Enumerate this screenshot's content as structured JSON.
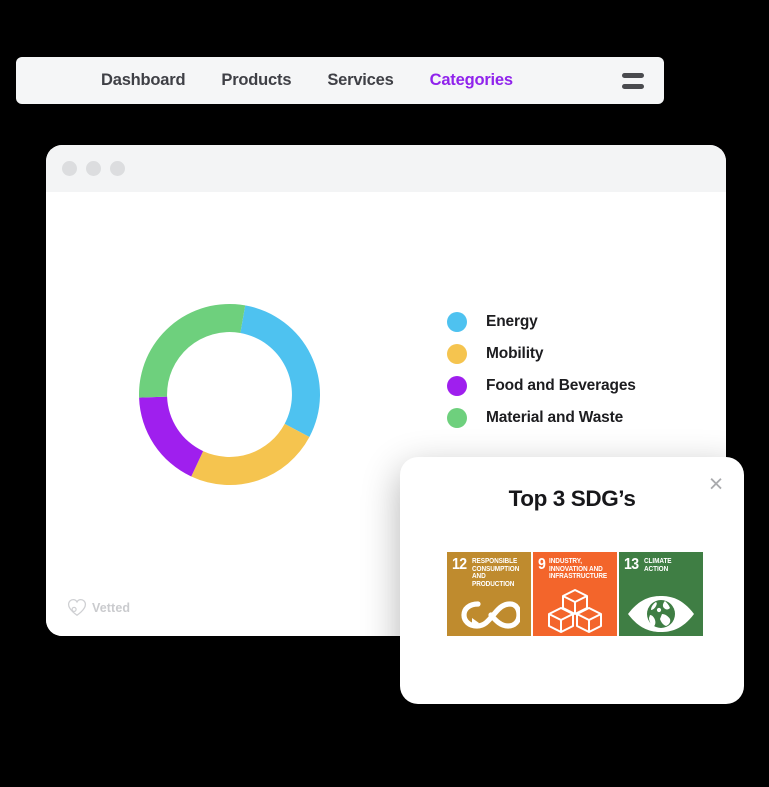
{
  "page": {
    "background_color": "#000000"
  },
  "browser": {
    "title_bar": {
      "dots": [
        "window-dot-1",
        "window-dot-2",
        "window-dot-3"
      ],
      "dot_color": "#dcdddf"
    },
    "nav": {
      "items": [
        {
          "label": "Dashboard",
          "active": false
        },
        {
          "label": "Products",
          "active": false
        },
        {
          "label": "Services",
          "active": false
        },
        {
          "label": "Categories",
          "active": true
        }
      ],
      "active_color": "#9023ec",
      "inactive_color": "#3f4046",
      "menu_icon": "hamburger-icon"
    }
  },
  "chart_data": {
    "type": "pie",
    "title": "",
    "variant": "donut",
    "categories": [
      "Energy",
      "Mobility",
      "Food and Beverages",
      "Material and Waste"
    ],
    "values": [
      30,
      24,
      17.5,
      28.5
    ],
    "unit": "%",
    "colors": [
      "#4ec2f0",
      "#f4c košice"
    ],
    "series_colors": [
      "#4ec2f0",
      "#f5c44f",
      "#9f1fee",
      "#6ed07d"
    ],
    "start_angle_deg": 10,
    "legend_position": "right",
    "inner_radius_ratio": 0.69,
    "segments": [
      {
        "label": "Energy",
        "value": 30,
        "color": "#4ec2f0",
        "start_deg": 10,
        "end_deg": 118
      },
      {
        "label": "Mobility",
        "value": 24,
        "color": "#f5c44f",
        "start_deg": 118,
        "end_deg": 205
      },
      {
        "label": "Food and Beverages",
        "value": 17.5,
        "color": "#9f1fee",
        "start_deg": 205,
        "end_deg": 268
      },
      {
        "label": "Material and Waste",
        "value": 28.5,
        "color": "#6ed07d",
        "start_deg": 268,
        "end_deg": 370
      }
    ]
  },
  "legend": {
    "items": [
      {
        "label": "Energy",
        "color": "#4ec2f0"
      },
      {
        "label": "Mobility",
        "color": "#f5c44f"
      },
      {
        "label": "Food and Beverages",
        "color": "#9f1fee"
      },
      {
        "label": "Material and Waste",
        "color": "#6ed07d"
      }
    ]
  },
  "watermark": {
    "label": "Vetted",
    "icon": "heart-logo-icon",
    "color": "#c8c9cc"
  },
  "sdg_card": {
    "title": "Top 3 SDG’s",
    "close_label": "×",
    "tiles": [
      {
        "number": "12",
        "name": "RESPONSIBLE CONSUMPTION AND PRODUCTION",
        "color": "#bf8b2e",
        "icon": "infinity-arrow-icon"
      },
      {
        "number": "9",
        "name": "INDUSTRY, INNOVATION AND INFRASTRUCTURE",
        "color": "#f3652b",
        "icon": "cubes-icon"
      },
      {
        "number": "13",
        "name": "CLIMATE ACTION",
        "color": "#3f7e44",
        "icon": "eye-globe-icon"
      }
    ]
  }
}
